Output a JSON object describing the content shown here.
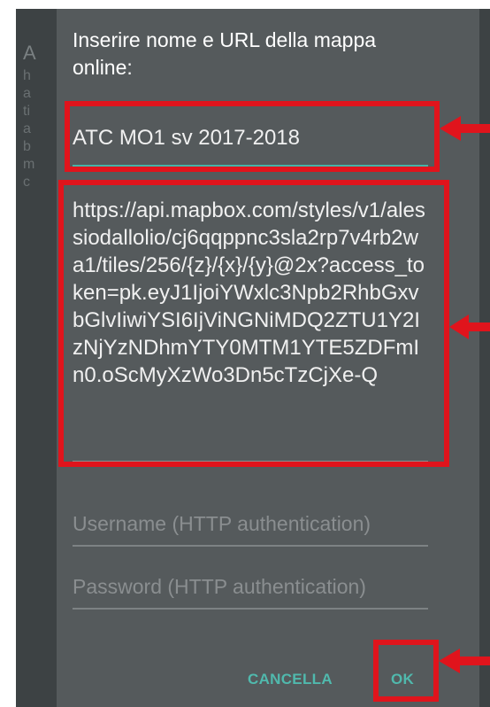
{
  "background": {
    "title_fragment": "A",
    "text_fragments": [
      "h",
      "a",
      "ti",
      "a",
      "b",
      "m",
      "c"
    ]
  },
  "dialog": {
    "title": "Inserire nome e URL della mappa online:",
    "name_value": "ATC MO1 sv 2017-2018",
    "url_value": "https://api.mapbox.com/styles/v1/alessiodallolio/cj6qqppnc3sla2rp7v4rb2wa1/tiles/256/{z}/{x}/{y}@2x?access_token=pk.eyJ1IjoiYWxlc3Npb2RhbGxvbGlvIiwiYSI6IjViNGNiMDQ2ZTU1Y2IzNjYzNDhmYTY0MTM1YTE5ZDFmIn0.oScMyXzWo3Dn5cTzCjXe-Q",
    "username_placeholder": "Username (HTTP authentication)",
    "password_placeholder": "Password (HTTP authentication)",
    "cancel_label": "CANCELLA",
    "ok_label": "OK"
  },
  "colors": {
    "screen_background": "#3d4244",
    "dialog_background": "#555a5c",
    "accent": "#50b9ad",
    "highlight": "#e0141c"
  },
  "icons": [
    "arrow-left-icon"
  ]
}
